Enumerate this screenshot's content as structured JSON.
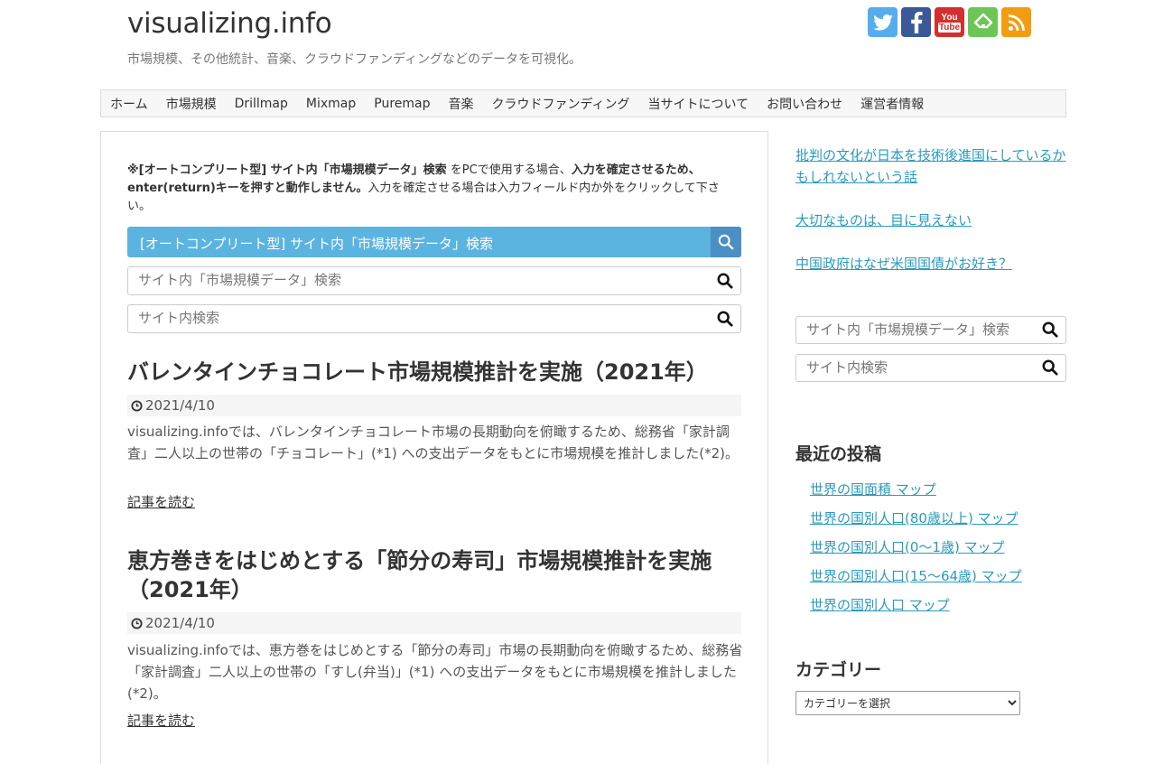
{
  "site": {
    "title": "visualizing.info",
    "tagline": "市場規模、その他統計、音楽、クラウドファンディングなどのデータを可視化。"
  },
  "social": [
    {
      "name": "twitter-icon",
      "glyph": "t",
      "color": "#55acee"
    },
    {
      "name": "facebook-icon",
      "glyph": "f",
      "color": "#3b5998"
    },
    {
      "name": "youtube-icon",
      "glyph": "You Tube",
      "color": "#d32f2f"
    },
    {
      "name": "feedly-icon",
      "glyph": "f",
      "color": "#6cc655"
    },
    {
      "name": "rss-icon",
      "glyph": "",
      "color": "#f39c12"
    }
  ],
  "nav": [
    "ホーム",
    "市場規模",
    "Drillmap",
    "Mixmap",
    "Puremap",
    "音楽",
    "クラウドファンディング",
    "当サイトについて",
    "お問い合わせ",
    "運営者情報"
  ],
  "notice": {
    "p1": "※[オートコンプリート型] サイト内「市場規模データ」検索",
    "p2": " をPCで使用する場合、",
    "p3": "入力を確定させるため、enter(return)キーを押すと動作しません。",
    "p4": "入力を確定させる場合は入力フィールド内か外をクリックして下さい。"
  },
  "autocomplete_label": "[オートコンプリート型] サイト内「市場規模データ」検索",
  "search": {
    "market_placeholder": "サイト内「市場規模データ」検索",
    "site_placeholder": "サイト内検索"
  },
  "posts": [
    {
      "title": "バレンタインチョコレート市場規模推計を実施（2021年）",
      "date": "2021/4/10",
      "excerpt": "visualizing.infoでは、バレンタインチョコレート市場の長期動向を俯瞰するため、総務省「家計調査」二人以上の世帯の「チョコレート」(*1) への支出データをもとに市場規模を推計しました(*2)。",
      "more": "記事を読む"
    },
    {
      "title": "恵方巻きをはじめとする「節分の寿司」市場規模推計を実施（2021年）",
      "date": "2021/4/10",
      "excerpt": "visualizing.infoでは、恵方巻をはじめとする「節分の寿司」市場の長期動向を俯瞰するため、総務省「家計調査」二人以上の世帯の「すし(弁当)」(*1) への支出データをもとに市場規模を推計しました(*2)。",
      "more": "記事を読む"
    }
  ],
  "sidebar": {
    "featured": [
      "批判の文化が日本を技術後進国にしているかもしれないという話",
      "大切なものは、目に見えない",
      "中国政府はなぜ米国国債がお好き？"
    ],
    "recent_heading": "最近の投稿",
    "recent": [
      "世界の国面積 マップ",
      "世界の国別人口(80歳以上) マップ",
      "世界の国別人口(0〜1歳) マップ",
      "世界の国別人口(15〜64歳) マップ",
      "世界の国別人口 マップ"
    ],
    "category_heading": "カテゴリー",
    "category_select": "カテゴリーを選択"
  }
}
